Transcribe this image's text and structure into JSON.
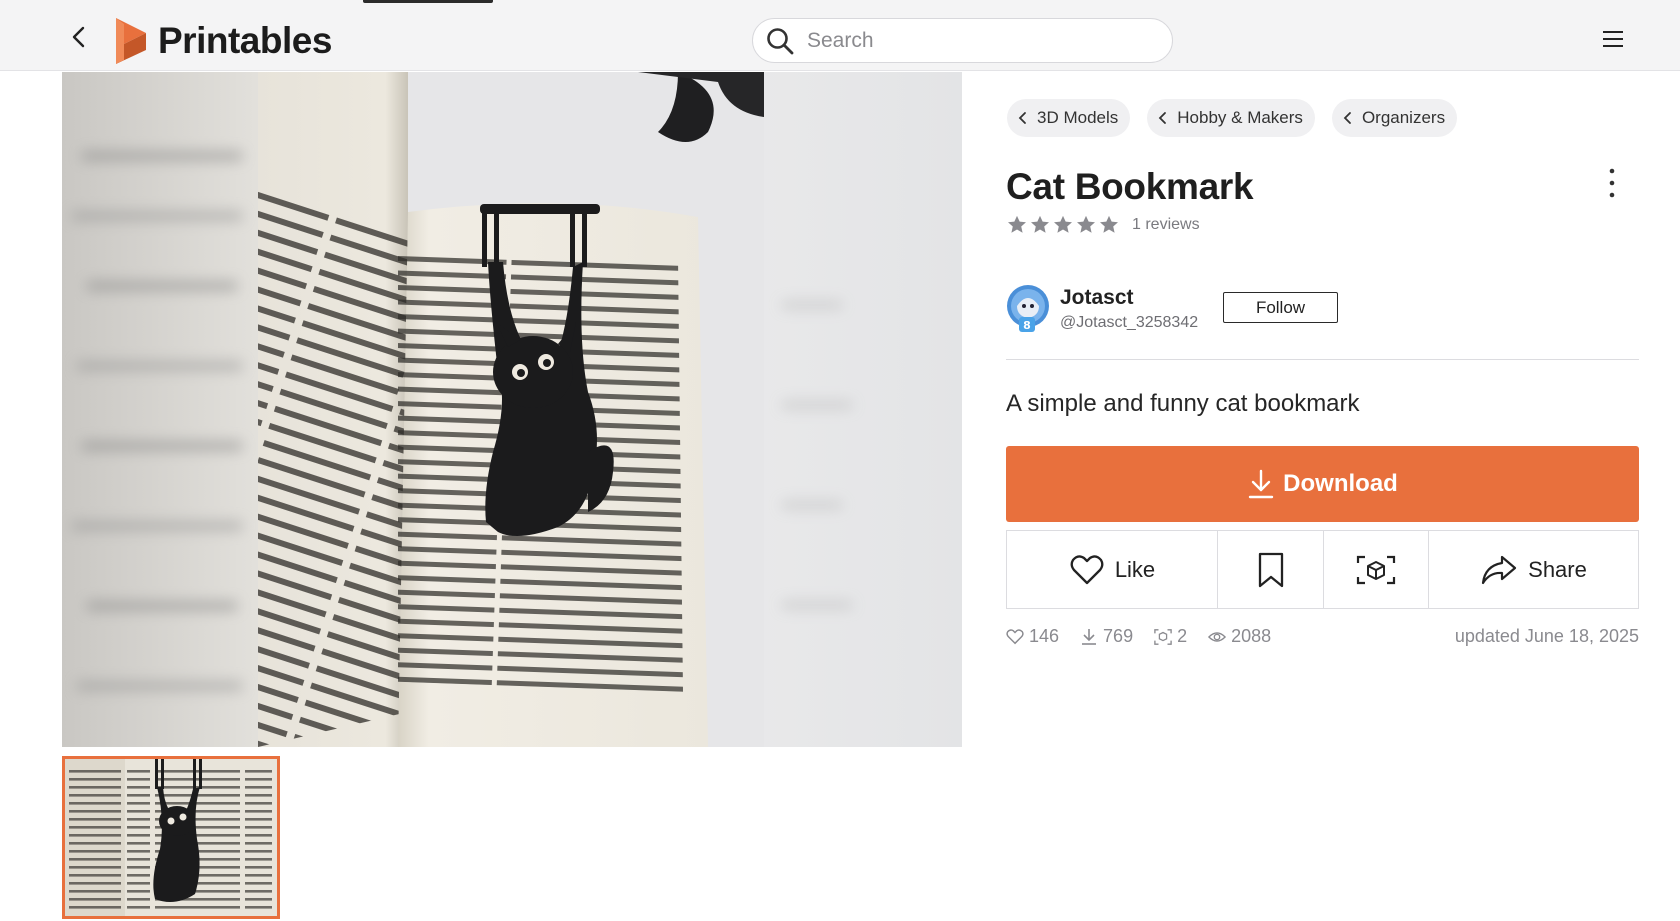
{
  "header": {
    "logo_text": "Printables",
    "search_placeholder": "Search"
  },
  "breadcrumbs": [
    "3D Models",
    "Hobby & Makers",
    "Organizers"
  ],
  "model": {
    "title": "Cat Bookmark",
    "rating": 5,
    "reviews": "1 reviews",
    "summary": "A simple and funny cat bookmark"
  },
  "author": {
    "name": "Jotasct",
    "handle": "@Jotasct_3258342",
    "avatar_badge": "8",
    "follow_label": "Follow"
  },
  "actions": {
    "download_label": "Download",
    "like_label": "Like",
    "share_label": "Share"
  },
  "stats": {
    "likes": "146",
    "downloads": "769",
    "makes": "2",
    "views": "2088",
    "updated": "updated June 18, 2025"
  },
  "colors": {
    "accent": "#e8703d",
    "star": "#8a8a8f"
  },
  "icons": [
    "chevron-left-icon",
    "printables-logo-icon",
    "search-icon",
    "hamburger-menu-icon",
    "kebab-menu-icon",
    "star-icon",
    "download-icon",
    "heart-icon",
    "bookmark-icon",
    "ar-view-icon",
    "share-icon",
    "eye-icon"
  ]
}
